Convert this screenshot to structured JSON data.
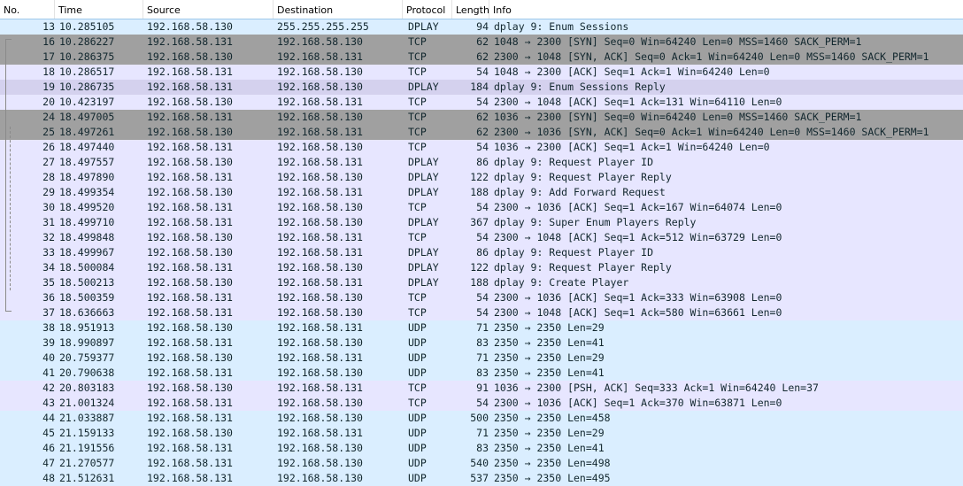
{
  "columns": {
    "no": "No.",
    "time": "Time",
    "source": "Source",
    "destination": "Destination",
    "protocol": "Protocol",
    "length": "Length",
    "info": "Info"
  },
  "colors": {
    "udp_row": "#daeeff",
    "tcp_row": "#e7e6ff",
    "tcp_syn_row": "#a0a0a0",
    "text": "#12272e"
  },
  "packets": [
    {
      "no": "13",
      "time": "10.285105",
      "source": "192.168.58.130",
      "destination": "255.255.255.255",
      "protocol": "DPLAY",
      "length": "94",
      "info": "dplay 9: Enum Sessions",
      "style": "sel"
    },
    {
      "no": "16",
      "time": "10.286227",
      "source": "192.168.58.131",
      "destination": "192.168.58.130",
      "protocol": "TCP",
      "length": "62",
      "info": "1048 → 2300 [SYN] Seq=0 Win=64240 Len=0 MSS=1460 SACK_PERM=1",
      "style": "syn"
    },
    {
      "no": "17",
      "time": "10.286375",
      "source": "192.168.58.130",
      "destination": "192.168.58.131",
      "protocol": "TCP",
      "length": "62",
      "info": "2300 → 1048 [SYN, ACK] Seq=0 Ack=1 Win=64240 Len=0 MSS=1460 SACK_PERM=1",
      "style": "syn"
    },
    {
      "no": "18",
      "time": "10.286517",
      "source": "192.168.58.131",
      "destination": "192.168.58.130",
      "protocol": "TCP",
      "length": "54",
      "info": "1048 → 2300 [ACK] Seq=1 Ack=1 Win=64240 Len=0",
      "style": "tcp"
    },
    {
      "no": "19",
      "time": "10.286735",
      "source": "192.168.58.131",
      "destination": "192.168.58.130",
      "protocol": "DPLAY",
      "length": "184",
      "info": "dplay 9: Enum Sessions Reply",
      "style": "alt"
    },
    {
      "no": "20",
      "time": "10.423197",
      "source": "192.168.58.130",
      "destination": "192.168.58.131",
      "protocol": "TCP",
      "length": "54",
      "info": "2300 → 1048 [ACK] Seq=1 Ack=131 Win=64110 Len=0",
      "style": "tcp"
    },
    {
      "no": "24",
      "time": "18.497005",
      "source": "192.168.58.131",
      "destination": "192.168.58.130",
      "protocol": "TCP",
      "length": "62",
      "info": "1036 → 2300 [SYN] Seq=0 Win=64240 Len=0 MSS=1460 SACK_PERM=1",
      "style": "syn"
    },
    {
      "no": "25",
      "time": "18.497261",
      "source": "192.168.58.130",
      "destination": "192.168.58.131",
      "protocol": "TCP",
      "length": "62",
      "info": "2300 → 1036 [SYN, ACK] Seq=0 Ack=1 Win=64240 Len=0 MSS=1460 SACK_PERM=1",
      "style": "syn"
    },
    {
      "no": "26",
      "time": "18.497440",
      "source": "192.168.58.131",
      "destination": "192.168.58.130",
      "protocol": "TCP",
      "length": "54",
      "info": "1036 → 2300 [ACK] Seq=1 Ack=1 Win=64240 Len=0",
      "style": "tcp"
    },
    {
      "no": "27",
      "time": "18.497557",
      "source": "192.168.58.130",
      "destination": "192.168.58.131",
      "protocol": "DPLAY",
      "length": "86",
      "info": "dplay 9: Request Player ID",
      "style": "dplay"
    },
    {
      "no": "28",
      "time": "18.497890",
      "source": "192.168.58.131",
      "destination": "192.168.58.130",
      "protocol": "DPLAY",
      "length": "122",
      "info": "dplay 9: Request Player Reply",
      "style": "dplay"
    },
    {
      "no": "29",
      "time": "18.499354",
      "source": "192.168.58.130",
      "destination": "192.168.58.131",
      "protocol": "DPLAY",
      "length": "188",
      "info": "dplay 9: Add Forward Request",
      "style": "dplay"
    },
    {
      "no": "30",
      "time": "18.499520",
      "source": "192.168.58.131",
      "destination": "192.168.58.130",
      "protocol": "TCP",
      "length": "54",
      "info": "2300 → 1036 [ACK] Seq=1 Ack=167 Win=64074 Len=0",
      "style": "tcp"
    },
    {
      "no": "31",
      "time": "18.499710",
      "source": "192.168.58.131",
      "destination": "192.168.58.130",
      "protocol": "DPLAY",
      "length": "367",
      "info": "dplay 9: Super Enum Players Reply",
      "style": "dplay"
    },
    {
      "no": "32",
      "time": "18.499848",
      "source": "192.168.58.130",
      "destination": "192.168.58.131",
      "protocol": "TCP",
      "length": "54",
      "info": "2300 → 1048 [ACK] Seq=1 Ack=512 Win=63729 Len=0",
      "style": "tcp"
    },
    {
      "no": "33",
      "time": "18.499967",
      "source": "192.168.58.130",
      "destination": "192.168.58.131",
      "protocol": "DPLAY",
      "length": "86",
      "info": "dplay 9: Request Player ID",
      "style": "dplay"
    },
    {
      "no": "34",
      "time": "18.500084",
      "source": "192.168.58.131",
      "destination": "192.168.58.130",
      "protocol": "DPLAY",
      "length": "122",
      "info": "dplay 9: Request Player Reply",
      "style": "dplay"
    },
    {
      "no": "35",
      "time": "18.500213",
      "source": "192.168.58.130",
      "destination": "192.168.58.131",
      "protocol": "DPLAY",
      "length": "188",
      "info": "dplay 9: Create Player",
      "style": "dplay"
    },
    {
      "no": "36",
      "time": "18.500359",
      "source": "192.168.58.131",
      "destination": "192.168.58.130",
      "protocol": "TCP",
      "length": "54",
      "info": "2300 → 1036 [ACK] Seq=1 Ack=333 Win=63908 Len=0",
      "style": "tcp"
    },
    {
      "no": "37",
      "time": "18.636663",
      "source": "192.168.58.131",
      "destination": "192.168.58.130",
      "protocol": "TCP",
      "length": "54",
      "info": "2300 → 1048 [ACK] Seq=1 Ack=580 Win=63661 Len=0",
      "style": "tcp"
    },
    {
      "no": "38",
      "time": "18.951913",
      "source": "192.168.58.130",
      "destination": "192.168.58.131",
      "protocol": "UDP",
      "length": "71",
      "info": "2350 → 2350 Len=29",
      "style": "udp"
    },
    {
      "no": "39",
      "time": "18.990897",
      "source": "192.168.58.131",
      "destination": "192.168.58.130",
      "protocol": "UDP",
      "length": "83",
      "info": "2350 → 2350 Len=41",
      "style": "udp"
    },
    {
      "no": "40",
      "time": "20.759377",
      "source": "192.168.58.130",
      "destination": "192.168.58.131",
      "protocol": "UDP",
      "length": "71",
      "info": "2350 → 2350 Len=29",
      "style": "udp"
    },
    {
      "no": "41",
      "time": "20.790638",
      "source": "192.168.58.131",
      "destination": "192.168.58.130",
      "protocol": "UDP",
      "length": "83",
      "info": "2350 → 2350 Len=41",
      "style": "udp"
    },
    {
      "no": "42",
      "time": "20.803183",
      "source": "192.168.58.130",
      "destination": "192.168.58.131",
      "protocol": "TCP",
      "length": "91",
      "info": "1036 → 2300 [PSH, ACK] Seq=333 Ack=1 Win=64240 Len=37",
      "style": "tcp"
    },
    {
      "no": "43",
      "time": "21.001324",
      "source": "192.168.58.131",
      "destination": "192.168.58.130",
      "protocol": "TCP",
      "length": "54",
      "info": "2300 → 1036 [ACK] Seq=1 Ack=370 Win=63871 Len=0",
      "style": "tcp"
    },
    {
      "no": "44",
      "time": "21.033887",
      "source": "192.168.58.131",
      "destination": "192.168.58.130",
      "protocol": "UDP",
      "length": "500",
      "info": "2350 → 2350 Len=458",
      "style": "udp"
    },
    {
      "no": "45",
      "time": "21.159133",
      "source": "192.168.58.130",
      "destination": "192.168.58.131",
      "protocol": "UDP",
      "length": "71",
      "info": "2350 → 2350 Len=29",
      "style": "udp"
    },
    {
      "no": "46",
      "time": "21.191556",
      "source": "192.168.58.131",
      "destination": "192.168.58.130",
      "protocol": "UDP",
      "length": "83",
      "info": "2350 → 2350 Len=41",
      "style": "udp"
    },
    {
      "no": "47",
      "time": "21.270577",
      "source": "192.168.58.131",
      "destination": "192.168.58.130",
      "protocol": "UDP",
      "length": "540",
      "info": "2350 → 2350 Len=498",
      "style": "udp"
    },
    {
      "no": "48",
      "time": "21.512631",
      "source": "192.168.58.131",
      "destination": "192.168.58.130",
      "protocol": "UDP",
      "length": "537",
      "info": "2350 → 2350 Len=495",
      "style": "udp"
    }
  ]
}
